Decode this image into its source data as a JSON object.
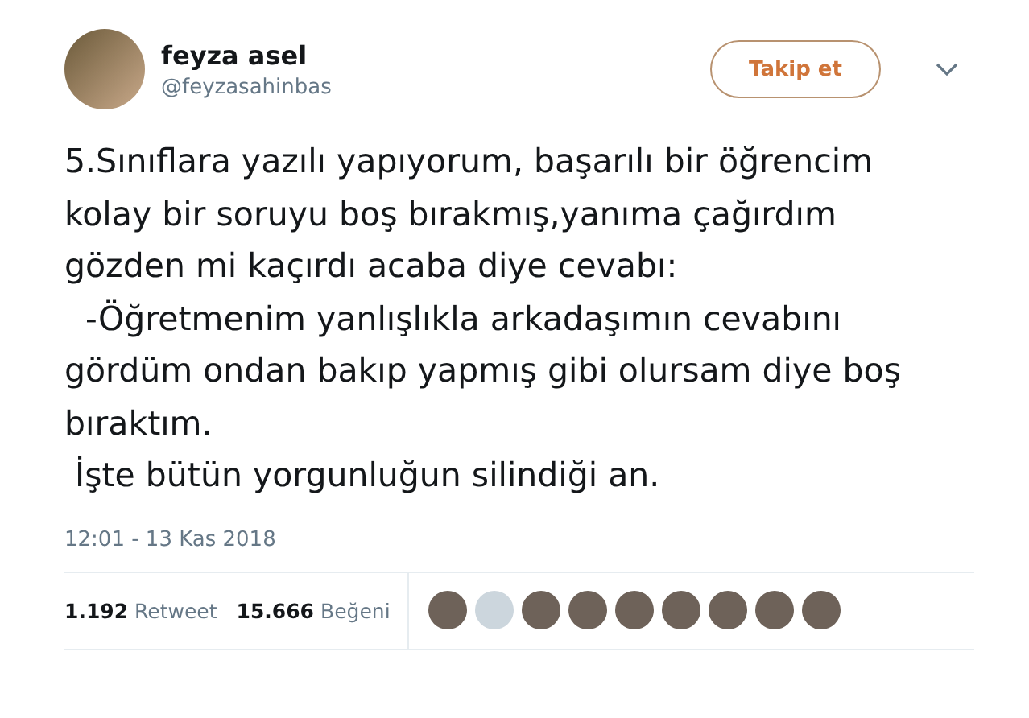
{
  "author": {
    "name": "feyza asel",
    "handle": "@feyzasahinbas"
  },
  "follow_button": "Takip et",
  "paragraphs": [
    "5.Sınıflara yazılı yapıyorum, başarılı bir öğrencim kolay bir soruyu boş bırakmış,yanıma çağırdım gözden mi kaçırdı acaba diye cevabı:",
    "  -Öğretmenim yanlışlıkla arkadaşımın cevabını gördüm ondan bakıp yapmış gibi olursam diye boş bıraktım.",
    " İşte bütün yorgunluğun silindiği an."
  ],
  "timestamp": "12:01 - 13 Kas 2018",
  "stats": [
    {
      "count": "1.192",
      "label": "Retweet"
    },
    {
      "count": "15.666",
      "label": "Beğeni"
    }
  ],
  "likers": [
    {
      "kind": "photo"
    },
    {
      "kind": "default"
    },
    {
      "kind": "photo"
    },
    {
      "kind": "photo"
    },
    {
      "kind": "photo"
    },
    {
      "kind": "photo"
    },
    {
      "kind": "photo"
    },
    {
      "kind": "photo"
    },
    {
      "kind": "photo"
    }
  ]
}
